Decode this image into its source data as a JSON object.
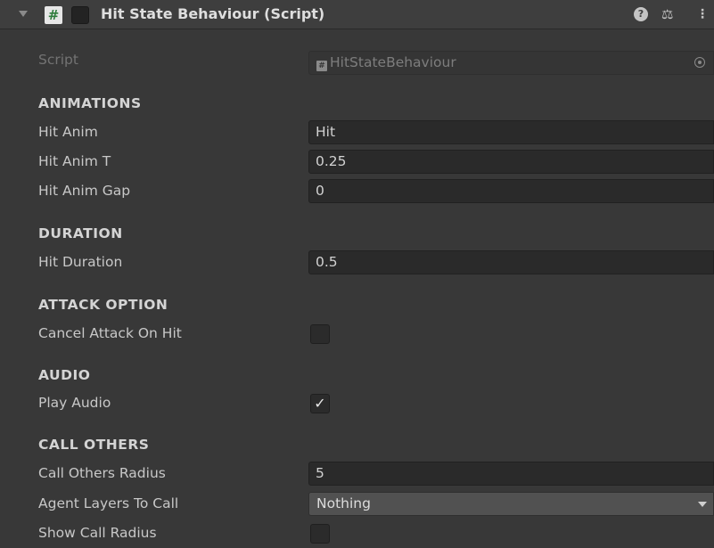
{
  "header": {
    "title": "Hit State Behaviour (Script)",
    "script_icon_glyph": "#",
    "icons": [
      "foldout-arrow-icon",
      "csharp-script-icon",
      "help-icon",
      "presets-icon",
      "kebab-menu-icon"
    ],
    "help_glyph": "?",
    "preset_glyph": "⚖",
    "menu_glyph": "⋮"
  },
  "script": {
    "label": "Script",
    "value": "HitStateBehaviour",
    "icon_glyph": "#"
  },
  "sections": {
    "animations": {
      "title": "ANIMATIONS",
      "hit_anim_label": "Hit Anim",
      "hit_anim_value": "Hit",
      "hit_anim_t_label": "Hit Anim T",
      "hit_anim_t_value": "0.25",
      "hit_anim_gap_label": "Hit Anim Gap",
      "hit_anim_gap_value": "0"
    },
    "duration": {
      "title": "DURATION",
      "hit_duration_label": "Hit Duration",
      "hit_duration_value": "0.5"
    },
    "attack_option": {
      "title": "ATTACK OPTION",
      "cancel_attack_label": "Cancel Attack On Hit",
      "cancel_attack_checked": false
    },
    "audio": {
      "title": "AUDIO",
      "play_audio_label": "Play Audio",
      "play_audio_checked": true,
      "check_glyph": "✓"
    },
    "call_others": {
      "title": "CALL OTHERS",
      "radius_label": "Call Others Radius",
      "radius_value": "5",
      "layers_label": "Agent Layers To Call",
      "layers_value": "Nothing",
      "show_radius_label": "Show Call Radius",
      "show_radius_checked": false
    }
  },
  "colors": {
    "background": "#383838",
    "header": "#3e3e3e",
    "field": "#2a2a2a",
    "dropdown": "#515151",
    "script_icon_hash": "#2f7d3c"
  }
}
